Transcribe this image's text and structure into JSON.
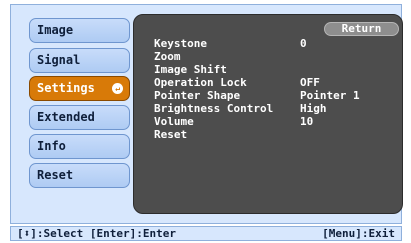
{
  "menu": {
    "tabs": [
      {
        "label": "Image"
      },
      {
        "label": "Signal"
      },
      {
        "label": "Settings"
      },
      {
        "label": "Extended"
      },
      {
        "label": "Info"
      },
      {
        "label": "Reset"
      }
    ],
    "active_tab": "Settings",
    "active_color": "#d87a08"
  },
  "panel": {
    "return_label": "Return",
    "items": [
      {
        "label": "Keystone",
        "value": "0"
      },
      {
        "label": "Zoom",
        "value": ""
      },
      {
        "label": "Image Shift",
        "value": ""
      },
      {
        "label": "Operation Lock",
        "value": "OFF"
      },
      {
        "label": "Pointer Shape",
        "value": "Pointer 1"
      },
      {
        "label": "Brightness Control",
        "value": "High"
      },
      {
        "label": "Volume",
        "value": "10"
      },
      {
        "label": "Reset",
        "value": ""
      }
    ]
  },
  "status_bar": {
    "left": "[⬍]:Select [Enter]:Enter",
    "right": "[Menu]:Exit"
  }
}
